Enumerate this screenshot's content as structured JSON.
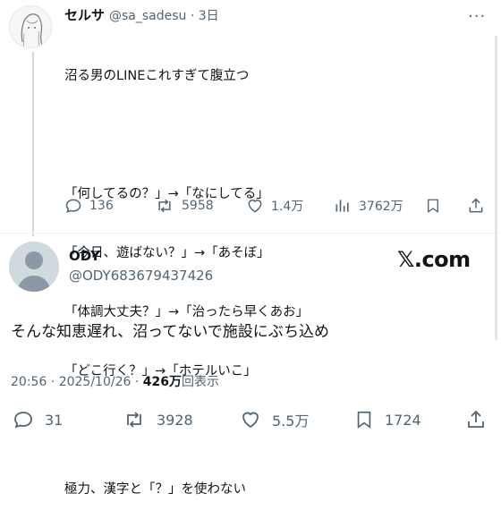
{
  "quoted": {
    "name": "セルサ",
    "handle_time": "@sa_sadesu · 3日",
    "lines": [
      "沼る男のLINEこれすぎて腹立つ",
      "",
      "「何してるの？」→「なにしてる」",
      "「今日、遊ばない？」→「あそぼ」",
      "「体調大丈夫？」→「治ったら早くあお」",
      "「どこ行く？」→「ホテルいこ」",
      "",
      "極力、漢字と「？」を使わない"
    ],
    "replies": "136",
    "reposts": "5958",
    "likes": "1.4万",
    "views": "3762万"
  },
  "tweet": {
    "name": "ODY",
    "handle": "@ODY683679437426",
    "site_label": "𝕏.com",
    "text": "そんな知恵遅れ、沼ってないで施設にぶち込め",
    "time": "20:56 · 2025/10/26 · ",
    "views_count": "426万",
    "views_label": "回表示",
    "replies": "31",
    "reposts": "3928",
    "likes": "5.5万",
    "bookmarks": "1724"
  },
  "colors": {
    "muted": "#536471",
    "text": "#0f1419",
    "line": "#cfd9de"
  },
  "icons": [
    "more-icon",
    "reply-icon",
    "repost-icon",
    "like-icon",
    "views-icon",
    "bookmark-icon",
    "share-icon"
  ]
}
